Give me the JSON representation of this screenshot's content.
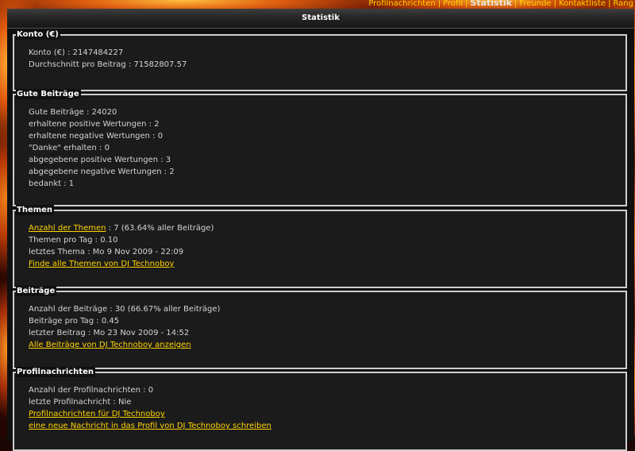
{
  "topnav": {
    "items": [
      "Profilnachrichten",
      "Profil",
      "Statistik",
      "Freunde",
      "Kontaktliste",
      "Rang"
    ],
    "separator": "|",
    "active": "Statistik"
  },
  "header": {
    "title": "Statistik"
  },
  "sections": {
    "konto": {
      "title": "Konto (€)",
      "rows": [
        "Konto (€) : 2147484227",
        "Durchschnitt pro Beitrag : 71582807.57"
      ]
    },
    "gute": {
      "title": "Gute Beiträge",
      "rows": [
        "Gute Beiträge : 24020",
        "erhaltene positive Wertungen : 2",
        "erhaltene negative Wertungen : 0",
        "\"Danke\" erhalten : 0",
        "abgegebene positive Wertungen : 3",
        "abgegebene negative Wertungen : 2",
        "bedankt : 1"
      ]
    },
    "themen": {
      "title": "Themen",
      "count_link": "Anzahl der Themen",
      "count_value": ": 7 (63.64% aller Beiträge)",
      "per_day": "Themen pro Tag : 0.10",
      "last": "letztes Thema : Mo 9 Nov 2009 - 22:09",
      "find_link": "Finde alle Themen von DJ Technoboy"
    },
    "beitraege": {
      "title": "Beiträge",
      "count": "Anzahl der Beiträge : 30 (66.67% aller Beiträge)",
      "per_day": "Beiträge pro Tag : 0.45",
      "last": "letzter Beitrag : Mo 23 Nov 2009 - 14:52",
      "all_link": "Alle Beiträge von DJ Technoboy anzeigen"
    },
    "profil": {
      "title": "Profilnachrichten",
      "count": "Anzahl der Profilnachrichten : 0",
      "last": "letzte Profilnachricht : Nie",
      "messages_link": "Profilnachrichten für DJ Technoboy",
      "write_link": "eine neue Nachricht in das Profil von DJ Technoboy schreiben"
    }
  },
  "colors": {
    "link": "#ffd400",
    "text": "#d4d4d4",
    "panel": "#101010",
    "section_bg": "#1b1b1b",
    "section_border": "#cfcfcf"
  }
}
